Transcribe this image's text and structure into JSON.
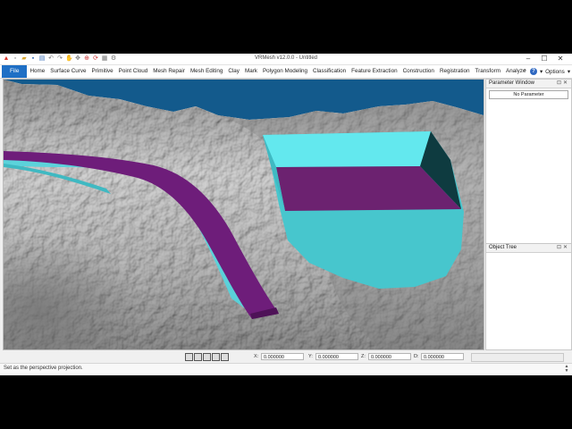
{
  "window": {
    "title": "VRMesh v12.0.0 - Untitled",
    "controls": [
      "minimize-icon",
      "maximize-icon",
      "close-icon"
    ]
  },
  "quick_access": [
    "app-icon",
    "new-icon",
    "open-icon",
    "save-icon",
    "export-icon",
    "undo-icon",
    "redo-icon",
    "hand-icon",
    "pan-icon",
    "fit-icon",
    "rotate-icon",
    "grid-icon",
    "settings-icon"
  ],
  "ribbon": {
    "file_label": "File",
    "tabs": [
      "Home",
      "Surface Curve",
      "Primitive",
      "Point Cloud",
      "Mesh Repair",
      "Mesh Editing",
      "Clay",
      "Mark",
      "Polygon Modeling",
      "Classification",
      "Feature Extraction",
      "Construction",
      "Registration",
      "Transform",
      "Analyze"
    ],
    "options_label": "Options",
    "help_icon": "help-icon"
  },
  "panels": {
    "parameter_window": {
      "title": "Parameter Window",
      "value": "No Parameter"
    },
    "object_tree": {
      "title": "Object Tree"
    }
  },
  "coordinates": {
    "x_label": "X:",
    "x_value": "0.000000",
    "y_label": "Y:",
    "y_value": "0.000000",
    "z_label": "Z:",
    "z_value": "0.000000",
    "d_label": "D:",
    "d_value": "0.000000"
  },
  "view_icons": [
    "view-front-icon",
    "view-top-icon",
    "view-side-icon",
    "view-iso-icon",
    "view-perspective-icon"
  ],
  "status": {
    "text": "Set as the perspective projection."
  },
  "colors": {
    "viewport_background": "#135a8c",
    "mesh_gray": "#bfbfbf",
    "cyan_surface": "#56d4dc",
    "purple_surface": "#6e1d7a",
    "file_tab": "#1f6fc5"
  }
}
